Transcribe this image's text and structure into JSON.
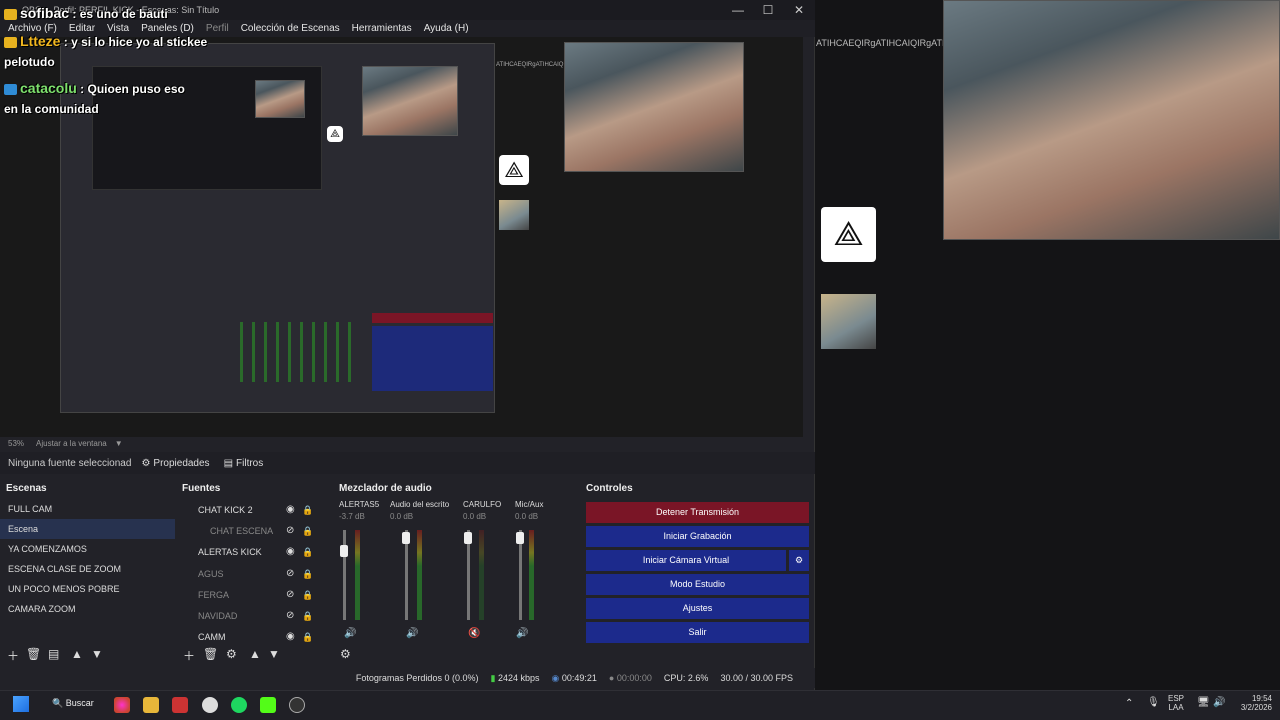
{
  "window": {
    "title": "OBS ... Perfil: PERFIL KICK - Escenas: Sin Título",
    "minimize": "—",
    "maximize": "☐",
    "close": "✕"
  },
  "menu": [
    "Archivo (F)",
    "Editar",
    "Vista",
    "Paneles (D)",
    "Perfil",
    "Colección de Escenas",
    "Herramientas",
    "Ayuda (H)"
  ],
  "chat": [
    {
      "user": "sofibac",
      "text": ": es uno de bauti"
    },
    {
      "user": "Ltteze",
      "text": ": y si lo hice yo al stickee"
    },
    {
      "line": "pelotudo"
    },
    {
      "user": "catacolu",
      "text": ": Quioen puso eso"
    },
    {
      "line": "en la comunidad"
    }
  ],
  "overlay_text": "ATIHCAEQIRgATIHCAIQIRgATI",
  "preview_status": {
    "zoom": "53%",
    "fit": "Ajustar a la ventana"
  },
  "source_bar": {
    "none": "Ninguna fuente seleccionad",
    "properties": "Propiedades",
    "filters": "Filtros"
  },
  "docks": {
    "scenes": "Escenas",
    "sources": "Fuentes",
    "mixer": "Mezclador de audio",
    "controls": "Controles"
  },
  "scenes": [
    "FULL CAM",
    "Escena",
    "YA COMENZAMOS",
    "ESCENA CLASE DE ZOOM",
    "UN POCO MENOS POBRE",
    "CAMARA ZOOM"
  ],
  "sources": [
    "CHAT KICK 2",
    "CHAT ESCENA",
    "ALERTAS KICK",
    "AGUS",
    "FERGA",
    "NAVIDAD",
    "CAMM"
  ],
  "mixer": [
    {
      "name": "ALERTAS5",
      "db": "-3.7 dB"
    },
    {
      "name": "Audio del escrito",
      "db": "0.0 dB"
    },
    {
      "name": "CARULFO",
      "db": "0.0 dB"
    },
    {
      "name": "Mic/Aux",
      "db": "0.0 dB"
    }
  ],
  "controls": [
    "Detener Transmisión",
    "Iniciar Grabación",
    "Iniciar Cámara Virtual",
    "Modo Estudio",
    "Ajustes",
    "Salir"
  ],
  "status": {
    "dropped": "Fotogramas Perdidos 0 (0.0%)",
    "kbps": "2424 kbps",
    "live": "00:49:21",
    "rec": "00:00:00",
    "cpu": "CPU: 2.6%",
    "fps": "30.00 / 30.00 FPS"
  },
  "taskbar": {
    "search": "Buscar",
    "lang1": "ESP",
    "lang2": "LAA",
    "time": "19:54",
    "date": "3/2/2026"
  }
}
